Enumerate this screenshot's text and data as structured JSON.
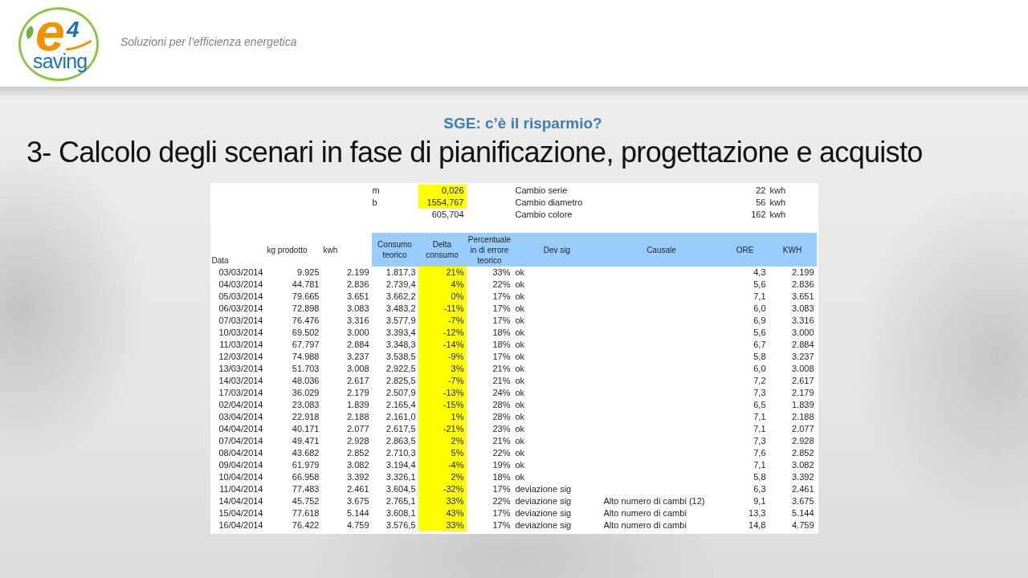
{
  "header": {
    "logo": {
      "letter": "e",
      "digit": "4",
      "wordmark": "saving"
    },
    "tagline": "Soluzioni per l’efficienza energetica"
  },
  "slide": {
    "subtitle": "SGE: c’è il risparmio?",
    "title": "3- Calcolo degli scenari in fase di pianificazione, progettazione e acquisto"
  },
  "spreadsheet": {
    "parameters": [
      {
        "symbol": "m",
        "value": "0,026",
        "highlighted": true,
        "change": "Cambio serie",
        "energy": "22",
        "unit": "kwh"
      },
      {
        "symbol": "b",
        "value": "1554,767",
        "highlighted": true,
        "change": "Cambio diametro",
        "energy": "56",
        "unit": "kwh"
      },
      {
        "value": "605,704",
        "highlighted": false,
        "change": "Cambio colore",
        "energy": "162",
        "unit": "kwh"
      }
    ],
    "columns": [
      {
        "label": "Data",
        "shaded": false,
        "highlighted": false
      },
      {
        "label": "kg prodotto",
        "shaded": false,
        "highlighted": false
      },
      {
        "label": "kwh",
        "shaded": false,
        "highlighted": false
      },
      {
        "label": "Consumo teorico",
        "shaded": true,
        "highlighted": false
      },
      {
        "label": "Delta consumo",
        "shaded": true,
        "highlighted": true
      },
      {
        "label": "Percentuale in di errore teorico",
        "shaded": true,
        "highlighted": false
      },
      {
        "label": "Dev sig",
        "shaded": true,
        "highlighted": false
      },
      {
        "label": "Causale",
        "shaded": true,
        "highlighted": false
      },
      {
        "label": "ORE",
        "shaded": true,
        "highlighted": false
      },
      {
        "label": "KWH",
        "shaded": true,
        "highlighted": false
      }
    ],
    "rows": [
      {
        "data": "03/03/2014",
        "kg_prodotto": "9.925",
        "kwh": "2.199",
        "consumo_teorico": "1.817,3",
        "delta_consumo": "21%",
        "percentuale": "33%",
        "dev_sig": "ok",
        "ore": "4,3",
        "kwh_2": "2.199"
      },
      {
        "data": "04/03/2014",
        "kg_prodotto": "44.781",
        "kwh": "2.836",
        "consumo_teorico": "2.739,4",
        "delta_consumo": "4%",
        "percentuale": "22%",
        "dev_sig": "ok",
        "ore": "5,6",
        "kwh_2": "2.836"
      },
      {
        "data": "05/03/2014",
        "kg_prodotto": "79.665",
        "kwh": "3.651",
        "consumo_teorico": "3.662,2",
        "delta_consumo": "0%",
        "percentuale": "17%",
        "dev_sig": "ok",
        "ore": "7,1",
        "kwh_2": "3.651"
      },
      {
        "data": "06/03/2014",
        "kg_prodotto": "72.898",
        "kwh": "3.083",
        "consumo_teorico": "3.483,2",
        "delta_consumo": "-11%",
        "percentuale": "17%",
        "dev_sig": "ok",
        "ore": "6,0",
        "kwh_2": "3.083"
      },
      {
        "data": "07/03/2014",
        "kg_prodotto": "76.476",
        "kwh": "3.316",
        "consumo_teorico": "3.577,9",
        "delta_consumo": "-7%",
        "percentuale": "17%",
        "dev_sig": "ok",
        "ore": "6,9",
        "kwh_2": "3.316"
      },
      {
        "data": "10/03/2014",
        "kg_prodotto": "69.502",
        "kwh": "3.000",
        "consumo_teorico": "3.393,4",
        "delta_consumo": "-12%",
        "percentuale": "18%",
        "dev_sig": "ok",
        "ore": "5,6",
        "kwh_2": "3.000"
      },
      {
        "data": "11/03/2014",
        "kg_prodotto": "67.797",
        "kwh": "2.884",
        "consumo_teorico": "3.348,3",
        "delta_consumo": "-14%",
        "percentuale": "18%",
        "dev_sig": "ok",
        "ore": "6,7",
        "kwh_2": "2.884"
      },
      {
        "data": "12/03/2014",
        "kg_prodotto": "74.988",
        "kwh": "3.237",
        "consumo_teorico": "3.538,5",
        "delta_consumo": "-9%",
        "percentuale": "17%",
        "dev_sig": "ok",
        "ore": "5,8",
        "kwh_2": "3.237"
      },
      {
        "data": "13/03/2014",
        "kg_prodotto": "51.703",
        "kwh": "3.008",
        "consumo_teorico": "2.922,5",
        "delta_consumo": "3%",
        "percentuale": "21%",
        "dev_sig": "ok",
        "ore": "6,0",
        "kwh_2": "3.008"
      },
      {
        "data": "14/03/2014",
        "kg_prodotto": "48.036",
        "kwh": "2.617",
        "consumo_teorico": "2.825,5",
        "delta_consumo": "-7%",
        "percentuale": "21%",
        "dev_sig": "ok",
        "ore": "7,2",
        "kwh_2": "2.617"
      },
      {
        "data": "17/03/2014",
        "kg_prodotto": "36.029",
        "kwh": "2.179",
        "consumo_teorico": "2.507,9",
        "delta_consumo": "-13%",
        "percentuale": "24%",
        "dev_sig": "ok",
        "ore": "7,3",
        "kwh_2": "2.179"
      },
      {
        "data": "02/04/2014",
        "kg_prodotto": "23.083",
        "kwh": "1.839",
        "consumo_teorico": "2.165,4",
        "delta_consumo": "-15%",
        "percentuale": "28%",
        "dev_sig": "ok",
        "ore": "6,5",
        "kwh_2": "1.839"
      },
      {
        "data": "03/04/2014",
        "kg_prodotto": "22.918",
        "kwh": "2.188",
        "consumo_teorico": "2.161,0",
        "delta_consumo": "1%",
        "percentuale": "28%",
        "dev_sig": "ok",
        "ore": "7,1",
        "kwh_2": "2.188"
      },
      {
        "data": "04/04/2014",
        "kg_prodotto": "40.171",
        "kwh": "2.077",
        "consumo_teorico": "2.617,5",
        "delta_consumo": "-21%",
        "percentuale": "23%",
        "dev_sig": "ok",
        "ore": "7,1",
        "kwh_2": "2.077"
      },
      {
        "data": "07/04/2014",
        "kg_prodotto": "49.471",
        "kwh": "2.928",
        "consumo_teorico": "2.863,5",
        "delta_consumo": "2%",
        "percentuale": "21%",
        "dev_sig": "ok",
        "ore": "7,3",
        "kwh_2": "2.928"
      },
      {
        "data": "08/04/2014",
        "kg_prodotto": "43.682",
        "kwh": "2.852",
        "consumo_teorico": "2.710,3",
        "delta_consumo": "5%",
        "percentuale": "22%",
        "dev_sig": "ok",
        "ore": "7,6",
        "kwh_2": "2.852"
      },
      {
        "data": "09/04/2014",
        "kg_prodotto": "61.979",
        "kwh": "3.082",
        "consumo_teorico": "3.194,4",
        "delta_consumo": "-4%",
        "percentuale": "19%",
        "dev_sig": "ok",
        "ore": "7,1",
        "kwh_2": "3.082"
      },
      {
        "data": "10/04/2014",
        "kg_prodotto": "66.958",
        "kwh": "3.392",
        "consumo_teorico": "3.326,1",
        "delta_consumo": "2%",
        "percentuale": "18%",
        "dev_sig": "ok",
        "ore": "5,8",
        "kwh_2": "3.392"
      },
      {
        "data": "11/04/2014",
        "kg_prodotto": "77.483",
        "kwh": "2.461",
        "consumo_teorico": "3.604,5",
        "delta_consumo": "-32%",
        "percentuale": "17%",
        "dev_sig": "deviazione sig",
        "ore": "6,3",
        "kwh_2": "2.461"
      },
      {
        "data": "14/04/2014",
        "kg_prodotto": "45.752",
        "kwh": "3.675",
        "consumo_teorico": "2.765,1",
        "delta_consumo": "33%",
        "percentuale": "22%",
        "dev_sig": "deviazione sig",
        "causale": "Alto numero di cambi (12)",
        "ore": "9,1",
        "kwh_2": "3.675"
      },
      {
        "data": "15/04/2014",
        "kg_prodotto": "77.618",
        "kwh": "5.144",
        "consumo_teorico": "3.608,1",
        "delta_consumo": "43%",
        "percentuale": "17%",
        "dev_sig": "deviazione sig",
        "causale": "Alto numero di cambi",
        "ore": "13,3",
        "kwh_2": "5.144"
      },
      {
        "data": "16/04/2014",
        "kg_prodotto": "76.422",
        "kwh": "4.759",
        "consumo_teorico": "3.576,5",
        "delta_consumo": "33%",
        "percentuale": "17%",
        "dev_sig": "deviazione sig",
        "causale": "Alto numero di cambi",
        "ore": "14,8",
        "kwh_2": "4.759"
      }
    ]
  }
}
